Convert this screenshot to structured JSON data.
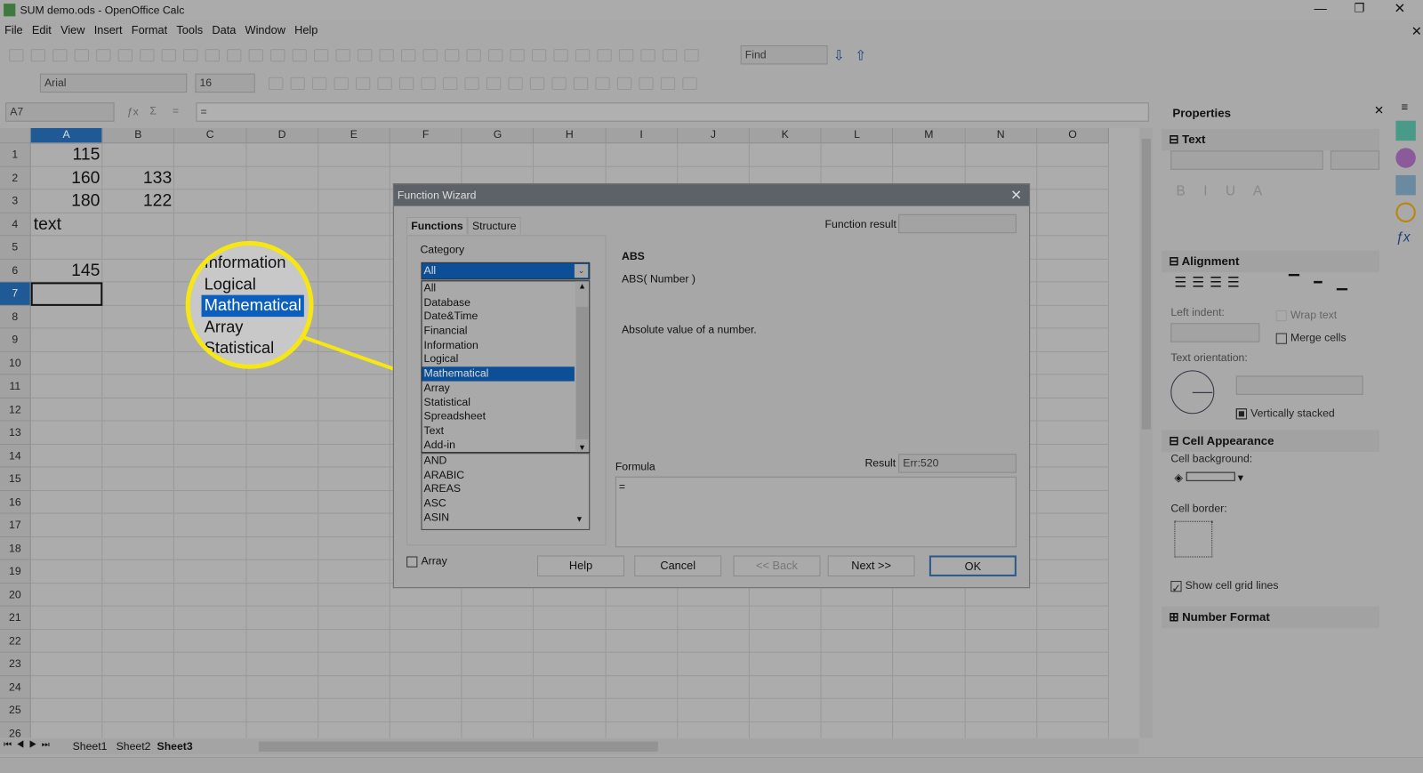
{
  "window": {
    "title": "SUM demo.ods - OpenOffice Calc"
  },
  "menu": [
    "File",
    "Edit",
    "View",
    "Insert",
    "Format",
    "Tools",
    "Data",
    "Window",
    "Help"
  ],
  "toolbar": {
    "find_placeholder": "Find",
    "font_name": "Arial",
    "font_size": "16"
  },
  "formula_bar": {
    "name_box": "A7",
    "content": "="
  },
  "columns": [
    "A",
    "B",
    "C",
    "D",
    "E",
    "F",
    "G",
    "H",
    "I",
    "J",
    "K",
    "L",
    "M",
    "N",
    "O"
  ],
  "rows": [
    "1",
    "2",
    "3",
    "4",
    "5",
    "6",
    "7",
    "8",
    "9",
    "10",
    "11",
    "12",
    "13",
    "14",
    "15",
    "16",
    "17",
    "18",
    "19",
    "20",
    "21",
    "22",
    "23",
    "24",
    "25",
    "26"
  ],
  "cells": [
    {
      "row": 1,
      "col": 0,
      "value": "115",
      "align": "right"
    },
    {
      "row": 2,
      "col": 0,
      "value": "160",
      "align": "right"
    },
    {
      "row": 2,
      "col": 1,
      "value": "133",
      "align": "right"
    },
    {
      "row": 3,
      "col": 0,
      "value": "180",
      "align": "right"
    },
    {
      "row": 3,
      "col": 1,
      "value": "122",
      "align": "right"
    },
    {
      "row": 4,
      "col": 0,
      "value": "text",
      "align": "left"
    },
    {
      "row": 6,
      "col": 0,
      "value": "145",
      "align": "right"
    }
  ],
  "selected_cell": "A7",
  "magnifier": {
    "items": [
      "Information",
      "Logical",
      "Mathematical",
      "Array",
      "Statistical"
    ],
    "highlighted": "Mathematical",
    "color": "#f5e614"
  },
  "dialog": {
    "title": "Function Wizard",
    "tabs": [
      "Functions",
      "Structure"
    ],
    "function_result_label": "Function result",
    "category_label": "Category",
    "category_selected": "All",
    "categories": [
      "All",
      "Database",
      "Date&Time",
      "Financial",
      "Information",
      "Logical",
      "Mathematical",
      "Array",
      "Statistical",
      "Spreadsheet",
      "Text",
      "Add-in"
    ],
    "category_highlighted": "Mathematical",
    "functions": [
      "AND",
      "ARABIC",
      "AREAS",
      "ASC",
      "ASIN"
    ],
    "function_name": "ABS",
    "function_syntax": "ABS( Number )",
    "function_description": "Absolute value of a number.",
    "formula_label": "Formula",
    "result_label": "Result",
    "result_value": "Err:520",
    "formula_value": "=",
    "array_label": "Array",
    "buttons": {
      "help": "Help",
      "cancel": "Cancel",
      "back": "<< Back",
      "next": "Next >>",
      "ok": "OK"
    }
  },
  "sidebar": {
    "title": "Properties",
    "text_section": "Text",
    "alignment_section": "Alignment",
    "left_indent": "Left indent:",
    "wrap_text": "Wrap text",
    "merge_cells": "Merge cells",
    "text_orientation": "Text orientation:",
    "vertically_stacked": "Vertically stacked",
    "cell_appearance": "Cell Appearance",
    "cell_background": "Cell background:",
    "cell_border": "Cell border:",
    "show_grid": "Show cell grid lines",
    "number_format": "Number Format"
  },
  "sheets": [
    "Sheet1",
    "Sheet2",
    "Sheet3"
  ],
  "active_sheet": "Sheet3",
  "colors": {
    "highlight": "#0d4f96",
    "dialog_title": "#5c6268"
  }
}
